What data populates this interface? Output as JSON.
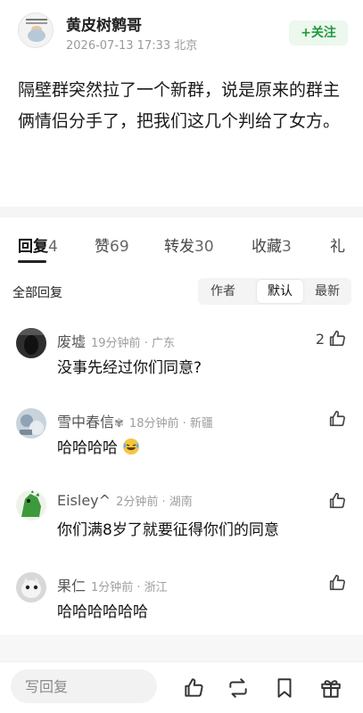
{
  "post": {
    "author": "黄皮树鹩哥",
    "meta": "2026-07-13 17:33 北京",
    "follow_label": "+关注",
    "body": "隔壁群突然拉了一个新群，说是原来的群主俩情侣分手了，把我们这几个判给了女方。"
  },
  "tabs": [
    {
      "label": "回复",
      "count": "4"
    },
    {
      "label": "赞",
      "count": "69"
    },
    {
      "label": "转发",
      "count": "30"
    },
    {
      "label": "收藏",
      "count": "3"
    },
    {
      "label": "礼",
      "count": ""
    }
  ],
  "sort": {
    "all_label": "全部回复",
    "options": [
      "作者",
      "默认",
      "最新"
    ],
    "selected": "默认"
  },
  "comments": [
    {
      "name": "废墟",
      "meta": "19分钟前 · 广东",
      "text": "没事先经过你们同意?",
      "likes": "2"
    },
    {
      "name": "雪中春信",
      "meta": "18分钟前 · 新疆",
      "text": "哈哈哈哈",
      "likes": ""
    },
    {
      "name": "Eisley^",
      "meta": "2分钟前 · 湖南",
      "text": "你们满8岁了就要征得你们的同意",
      "likes": ""
    },
    {
      "name": "果仁",
      "meta": "1分钟前 · 浙江",
      "text": "哈哈哈哈哈哈",
      "likes": ""
    }
  ],
  "bottom": {
    "reply_placeholder": "写回复"
  },
  "icons": {
    "like": "thumb-up-icon",
    "repost": "repost-icon",
    "bookmark": "bookmark-icon",
    "gift": "gift-icon",
    "emoji": "laughing-emoji-icon",
    "badge": "snowflake-badge-icon"
  },
  "colors": {
    "follow_green": "#1f9a3b",
    "follow_bg": "#ecf7ee",
    "meta_gray": "#9d9d9d"
  }
}
